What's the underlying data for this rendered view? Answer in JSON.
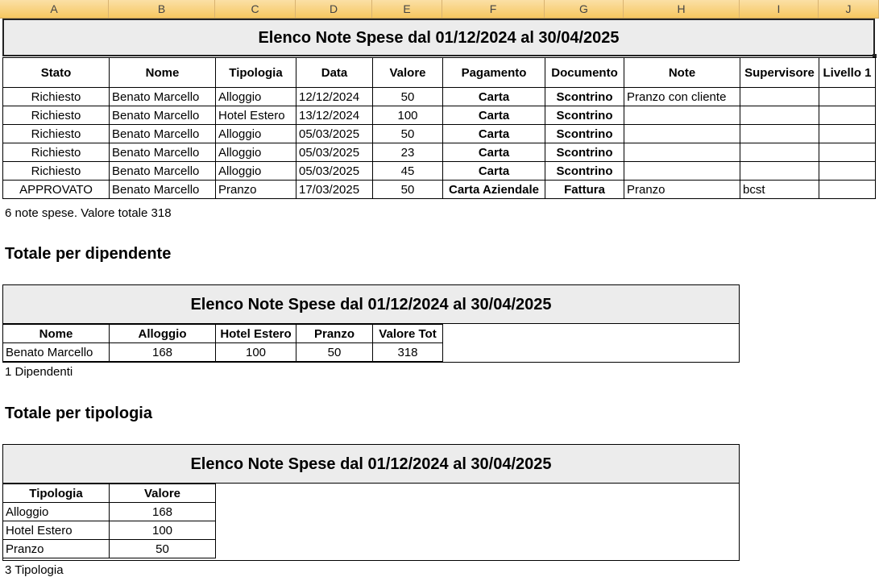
{
  "columns": [
    "A",
    "B",
    "C",
    "D",
    "E",
    "F",
    "G",
    "H",
    "I",
    "J"
  ],
  "main_table": {
    "title": "Elenco Note Spese dal 01/12/2024 al 30/04/2025",
    "headers": [
      "Stato",
      "Nome",
      "Tipologia",
      "Data",
      "Valore",
      "Pagamento",
      "Documento",
      "Note",
      "Supervisore",
      "Livello 1"
    ],
    "rows": [
      [
        "Richiesto",
        "Benato Marcello",
        "Alloggio",
        "12/12/2024",
        "50",
        "Carta",
        "Scontrino",
        "Pranzo con cliente",
        "",
        ""
      ],
      [
        "Richiesto",
        "Benato Marcello",
        "Hotel Estero",
        "13/12/2024",
        "100",
        "Carta",
        "Scontrino",
        "",
        "",
        ""
      ],
      [
        "Richiesto",
        "Benato Marcello",
        "Alloggio",
        "05/03/2025",
        "50",
        "Carta",
        "Scontrino",
        "",
        "",
        ""
      ],
      [
        "Richiesto",
        "Benato Marcello",
        "Alloggio",
        "05/03/2025",
        "23",
        "Carta",
        "Scontrino",
        "",
        "",
        ""
      ],
      [
        "Richiesto",
        "Benato Marcello",
        "Alloggio",
        "05/03/2025",
        "45",
        "Carta",
        "Scontrino",
        "",
        "",
        ""
      ],
      [
        "APPROVATO",
        "Benato Marcello",
        "Pranzo",
        "17/03/2025",
        "50",
        "Carta Aziendale",
        "Fattura",
        "Pranzo",
        "bcst",
        ""
      ]
    ],
    "summary": "6 note spese. Valore totale 318"
  },
  "by_employee": {
    "section_title": "Totale per dipendente",
    "title": "Elenco Note Spese dal 01/12/2024 al 30/04/2025",
    "headers": [
      "Nome",
      "Alloggio",
      "Hotel Estero",
      "Pranzo",
      "Valore Tot"
    ],
    "rows": [
      [
        "Benato Marcello",
        "168",
        "100",
        "50",
        "318"
      ]
    ],
    "summary": "1 Dipendenti"
  },
  "by_type": {
    "section_title": "Totale per tipologia",
    "title": "Elenco Note Spese dal 01/12/2024 al 30/04/2025",
    "headers": [
      "Tipologia",
      "Valore"
    ],
    "rows": [
      [
        "Alloggio",
        "168"
      ],
      [
        "Hotel Estero",
        "100"
      ],
      [
        "Pranzo",
        "50"
      ]
    ],
    "summary": "3 Tipologia"
  }
}
